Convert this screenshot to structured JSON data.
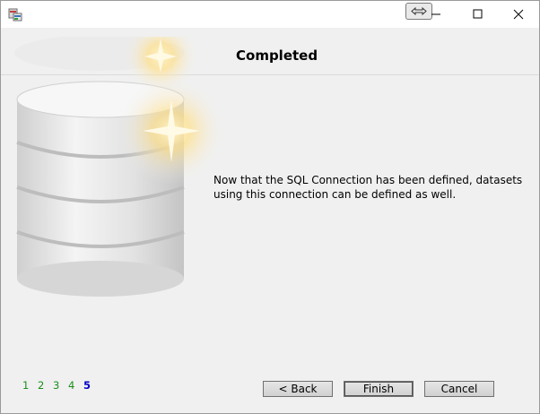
{
  "window": {
    "icon": "database-wizard-icon",
    "controls": [
      "resize-icon",
      "minimize-icon",
      "maximize-icon",
      "close-icon"
    ]
  },
  "header": {
    "title": "Completed"
  },
  "body": {
    "message": "Now that the SQL Connection has been defined, datasets using this connection can be defined as well."
  },
  "steps": {
    "items": [
      "1",
      "2",
      "3",
      "4",
      "5"
    ],
    "current": "5"
  },
  "buttons": {
    "back": "< Back",
    "finish": "Finish",
    "cancel": "Cancel"
  },
  "colors": {
    "step_done": "#1b8e1b",
    "step_current": "#0000c8"
  }
}
